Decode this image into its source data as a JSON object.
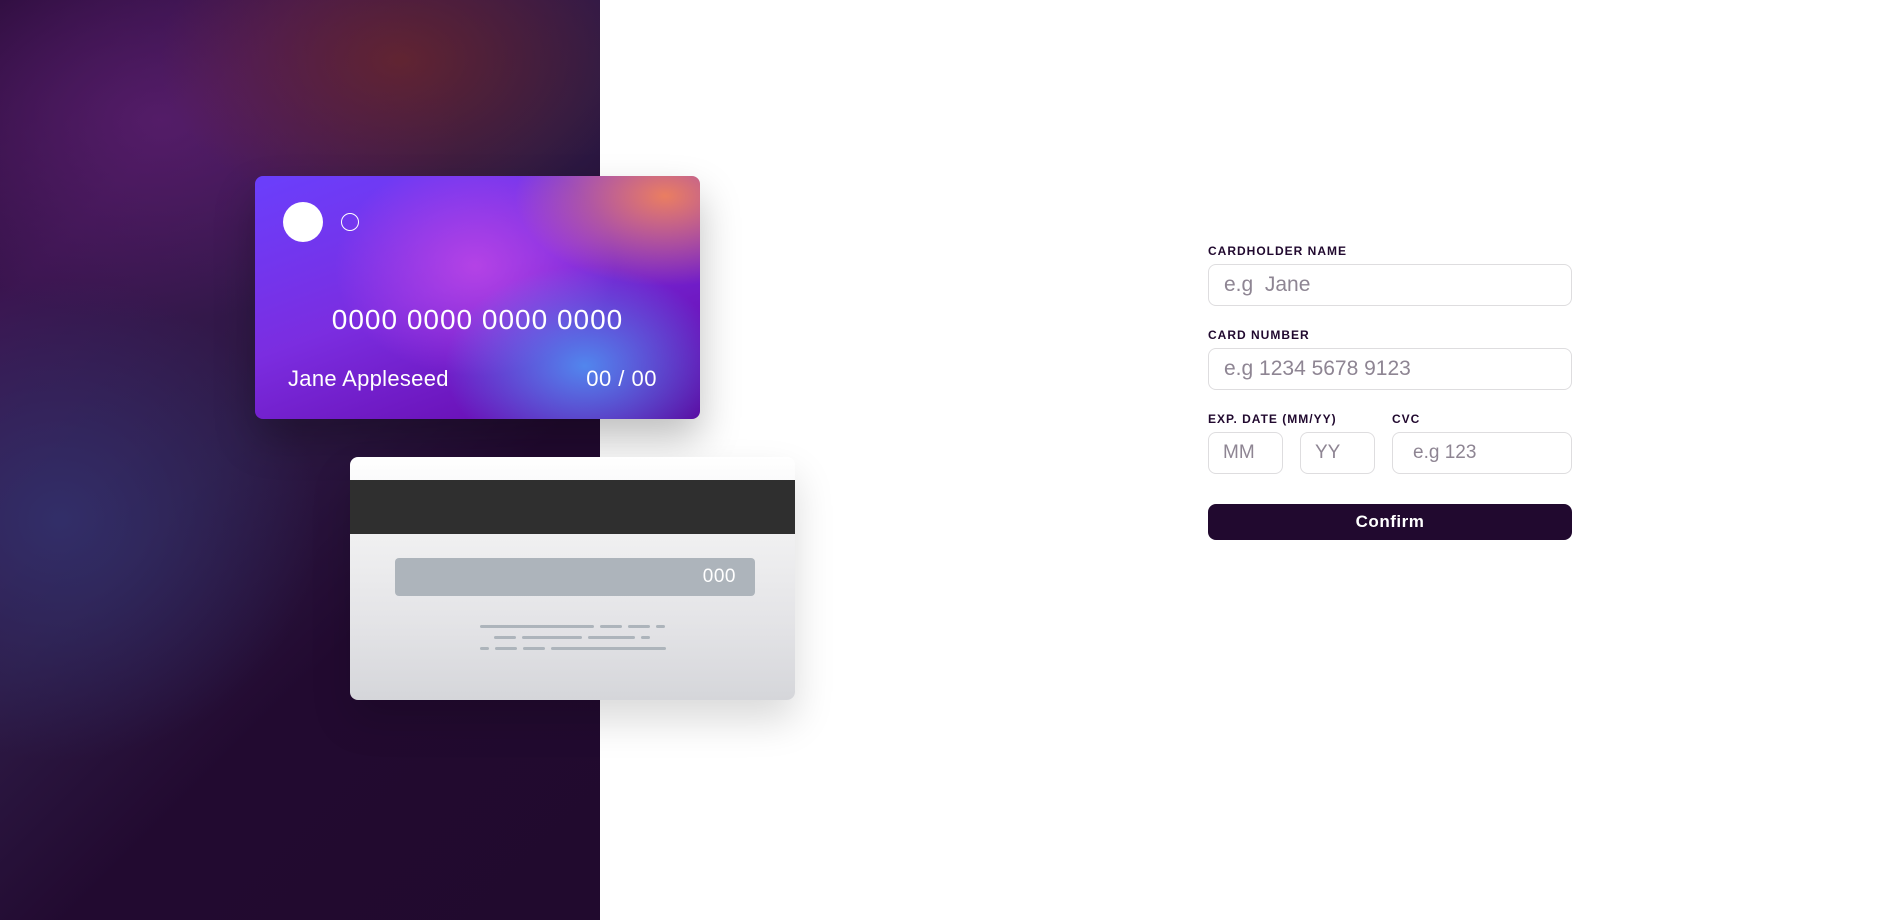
{
  "card_front": {
    "number": "0000 0000 0000 0000",
    "name": "Jane Appleseed",
    "expiry": "00 / 00"
  },
  "card_back": {
    "cvc": "000"
  },
  "form": {
    "cardholder_label": "CARDHOLDER NAME",
    "cardholder_placeholder": "e.g  Jane",
    "cardholder_value": "",
    "number_label": "CARD NUMBER",
    "number_placeholder": "e.g 1234 5678 9123",
    "number_value": "",
    "exp_label": "EXP. DATE (MM/YY)",
    "month_placeholder": "MM",
    "year_placeholder": "YY",
    "cvc_label": "CVC",
    "cvc_placeholder": "e.g 123",
    "confirm_label": "Confirm"
  },
  "colors": {
    "dark_violet": "#21092f",
    "input_border": "#dedddf",
    "placeholder": "#8e8593"
  }
}
